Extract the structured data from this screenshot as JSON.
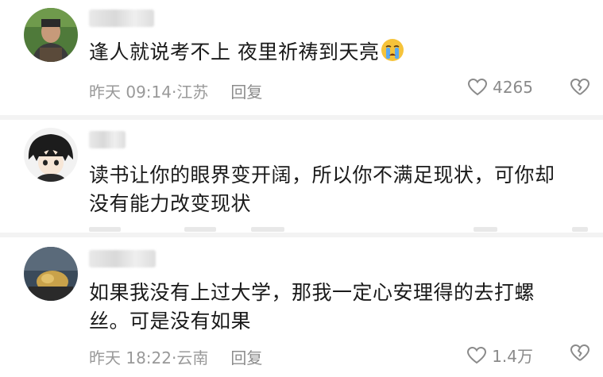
{
  "comments": [
    {
      "text": "逢人就说考不上 夜里祈祷到天亮",
      "emoji": "crying-face",
      "time": "昨天 09:14·江苏",
      "reply_label": "回复",
      "likes": "4265"
    },
    {
      "text": "读书让你的眼界变开阔，所以你不满足现状，可你却没有能力改变现状"
    },
    {
      "text": "如果我没有上过大学，那我一定心安理得的去打螺丝。可是没有如果",
      "time": "昨天 18:22·云南",
      "reply_label": "回复",
      "likes": "1.4万"
    }
  ],
  "icons": {
    "like": "heart-outline-icon",
    "dislike": "broken-heart-icon"
  },
  "colors": {
    "text": "#1a1a1a",
    "meta": "#999999",
    "icon": "#8a8a8a"
  }
}
